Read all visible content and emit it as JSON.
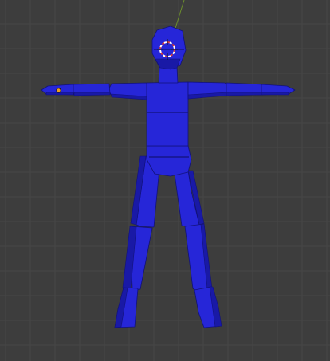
{
  "viewport": {
    "background_color": "#3d3d3d",
    "grid_line_color": "#464646",
    "axis_x_color": "#8a4b4b",
    "axis_z_color": "#6c8f2c"
  },
  "model": {
    "fill_color": "#2626d8",
    "shade_color": "#1919a6",
    "edge_color": "#12127a",
    "highlight_color": "#3838f0"
  },
  "cursor_3d": {
    "icon": "3d-cursor-icon",
    "ring_red": "#d83a3a",
    "ring_white": "#ffffff"
  },
  "object_origin": {
    "icon": "origin-dot-icon",
    "color": "#f0a020"
  }
}
